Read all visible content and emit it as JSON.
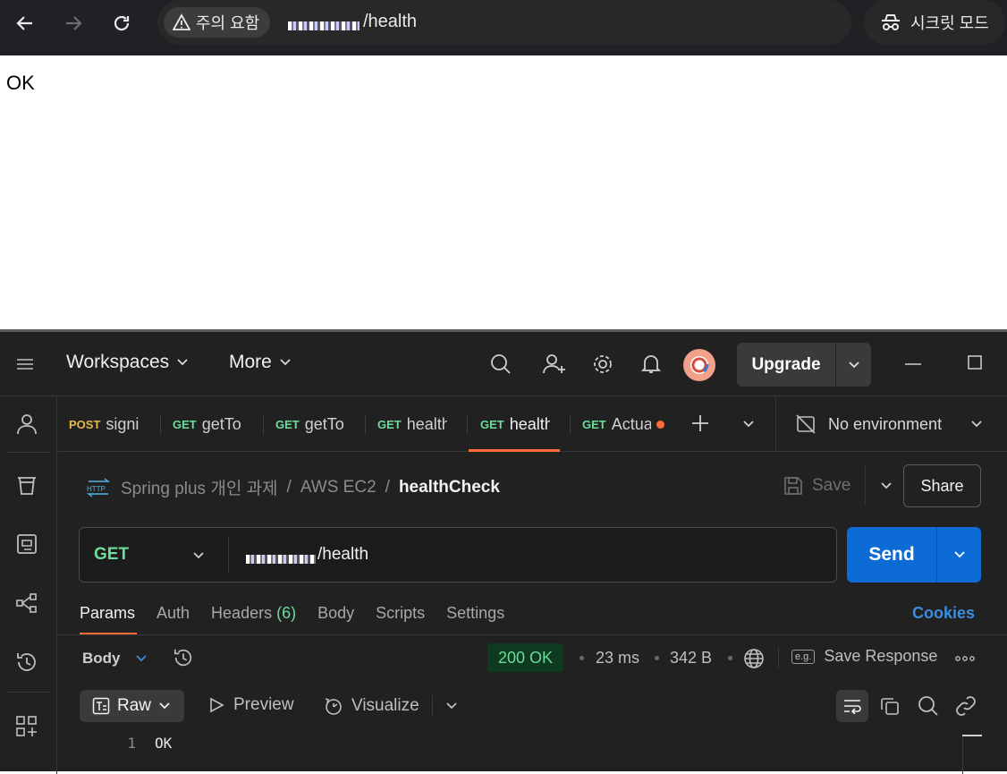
{
  "browser": {
    "security_chip": "주의 요함",
    "url_suffix": "/health",
    "incognito_label": "시크릿 모드",
    "page_text": "OK"
  },
  "postman": {
    "top": {
      "workspaces": "Workspaces",
      "more": "More",
      "upgrade": "Upgrade"
    },
    "tabs": [
      {
        "method": "POST",
        "name": "signi",
        "method_color": "#e8b64a"
      },
      {
        "method": "GET",
        "name": "getTo",
        "method_color": "#6bdd9a"
      },
      {
        "method": "GET",
        "name": "getTo",
        "method_color": "#6bdd9a"
      },
      {
        "method": "GET",
        "name": "health",
        "method_color": "#6bdd9a"
      },
      {
        "method": "GET",
        "name": "health",
        "method_color": "#6bdd9a"
      },
      {
        "method": "GET",
        "name": "Actua",
        "method_color": "#6bdd9a"
      }
    ],
    "environment": "No environment",
    "breadcrumb": {
      "collection": "Spring plus 개인 과제",
      "folder": "AWS EC2",
      "request": "healthCheck",
      "sep": "/"
    },
    "save": "Save",
    "share": "Share",
    "request": {
      "method": "GET",
      "url_suffix": "/health"
    },
    "send": "Send",
    "request_tabs": {
      "params": "Params",
      "auth": "Auth",
      "headers": "Headers",
      "headers_count": "(6)",
      "body": "Body",
      "scripts": "Scripts",
      "settings": "Settings"
    },
    "cookies": "Cookies",
    "response": {
      "body_label": "Body",
      "status": "200 OK",
      "time": "23 ms",
      "size": "342 B",
      "save_response": "Save Response",
      "eg_icon_text": "e.g."
    },
    "view": {
      "raw": "Raw",
      "preview": "Preview",
      "visualize": "Visualize"
    },
    "code": {
      "line_number": "1",
      "line_text": "OK"
    },
    "colors": {
      "accent": "#ff6c37",
      "send": "#0c6bd4",
      "get_method": "#6bdd9a",
      "post_method": "#e8b64a",
      "cookies": "#3b8de0"
    }
  }
}
